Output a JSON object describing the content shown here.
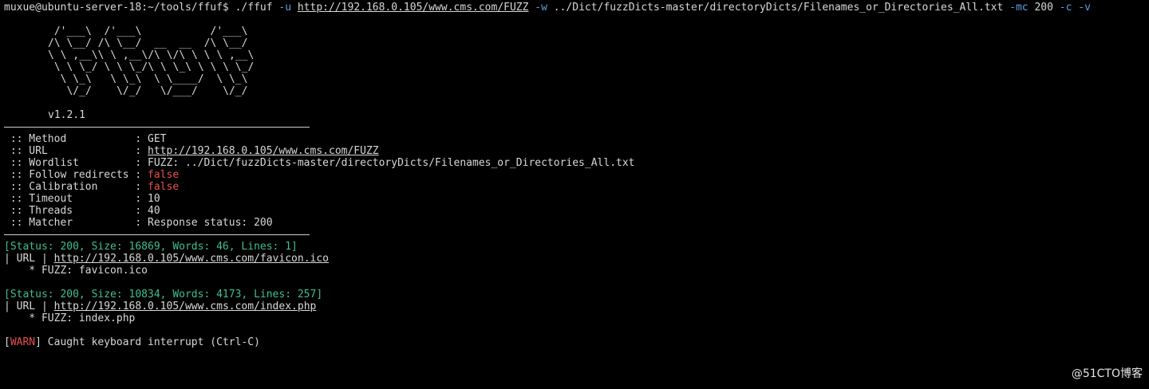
{
  "prompt": {
    "user_host": "muxue@ubuntu-server-18:~/tools/ffuf$",
    "cmd": "./ffuf",
    "flag_u": "-u",
    "url": "http://192.168.0.105/www.cms.com/FUZZ",
    "flag_w": "-w",
    "wordlist": "../Dict/fuzzDicts-master/directoryDicts/Filenames_or_Directories_All.txt",
    "flag_mc": "-mc",
    "mc_value": "200",
    "flag_c": "-c",
    "flag_v": "-v"
  },
  "banner": {
    "art": [
      " /'___\\  /'___\\           /'___\\",
      "/\\ \\__/ /\\ \\__/  __  __  /\\ \\__/",
      "\\ \\ ,__\\\\ \\ ,__\\/\\ \\/\\ \\ \\ \\ ,__\\",
      " \\ \\ \\_/ \\ \\ \\_/\\ \\ \\_\\ \\ \\ \\ \\_/",
      "  \\ \\_\\   \\ \\_\\  \\ \\____/  \\ \\_\\",
      "   \\/_/    \\/_/   \\/___/    \\/_/"
    ],
    "version": "v1.2.1"
  },
  "config": [
    {
      "label": " :: Method           : ",
      "value": "GET",
      "style": "plain"
    },
    {
      "label": " :: URL              : ",
      "value": "http://192.168.0.105/www.cms.com/FUZZ",
      "style": "link"
    },
    {
      "label": " :: Wordlist         : ",
      "value": "FUZZ: ../Dict/fuzzDicts-master/directoryDicts/Filenames_or_Directories_All.txt",
      "style": "plain"
    },
    {
      "label": " :: Follow redirects : ",
      "value": "false",
      "style": "red"
    },
    {
      "label": " :: Calibration      : ",
      "value": "false",
      "style": "red"
    },
    {
      "label": " :: Timeout          : ",
      "value": "10",
      "style": "plain"
    },
    {
      "label": " :: Threads          : ",
      "value": "40",
      "style": "plain"
    },
    {
      "label": " :: Matcher          : ",
      "value": "Response status: 200",
      "style": "plain"
    }
  ],
  "results": [
    {
      "status": "[Status: 200, Size: 16869, Words: 46, Lines: 1]",
      "url_prefix": "| URL | ",
      "url": "http://192.168.0.105/www.cms.com/favicon.ico",
      "fuzz": "    * FUZZ: favicon.ico"
    },
    {
      "status": "[Status: 200, Size: 10834, Words: 4173, Lines: 257]",
      "url_prefix": "| URL | ",
      "url": "http://192.168.0.105/www.cms.com/index.php",
      "fuzz": "    * FUZZ: index.php"
    }
  ],
  "warn": {
    "open": "[",
    "tag": "WARN",
    "close": "]",
    "message": " Caught keyboard interrupt (Ctrl-C)"
  },
  "watermark": "@51CTO博客",
  "colors": {
    "background": "#000000",
    "text": "#d8d8d8",
    "flag": "#5c9fe0",
    "false_value": "#e85050",
    "status": "#3fbf8f"
  }
}
